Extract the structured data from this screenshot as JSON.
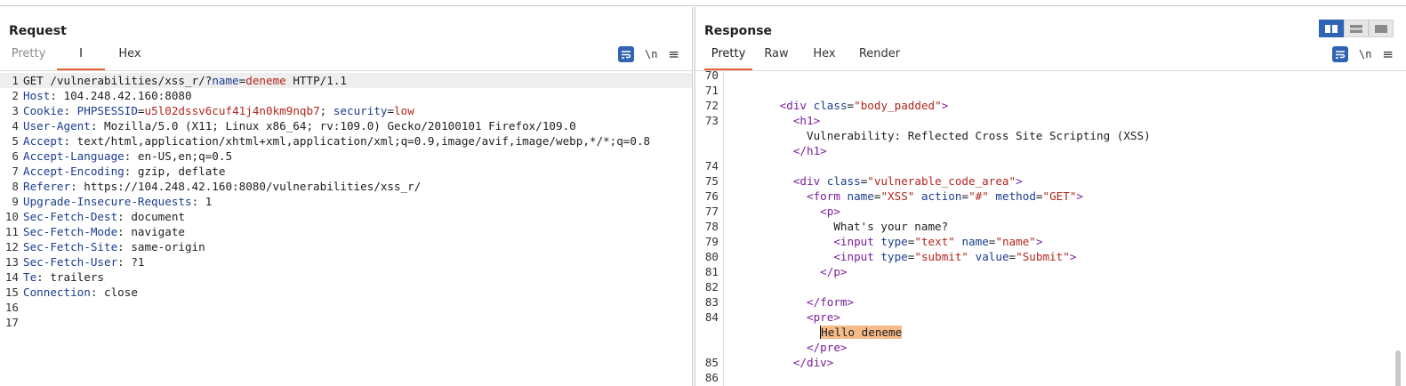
{
  "request": {
    "title": "Request",
    "tabs": [
      "Pretty",
      "I",
      "Hex"
    ],
    "toolbar": {
      "newline": "\\n",
      "menu": "≡"
    },
    "lines": [
      {
        "n": "1",
        "parts": [
          [
            "p",
            "GET /vulnerabilities/xss_r/?"
          ],
          [
            "k",
            "name"
          ],
          [
            "p",
            "="
          ],
          [
            "v",
            "deneme"
          ],
          [
            "p",
            " HTTP/1.1"
          ]
        ]
      },
      {
        "n": "2",
        "parts": [
          [
            "k",
            "Host"
          ],
          [
            "p",
            ": 104.248.42.160:8080"
          ]
        ]
      },
      {
        "n": "3",
        "parts": [
          [
            "k",
            "Cookie"
          ],
          [
            "p",
            ": "
          ],
          [
            "k",
            "PHPSESSID"
          ],
          [
            "p",
            "="
          ],
          [
            "v",
            "u5l02dssv6cuf41j4n0km9nqb7"
          ],
          [
            "p",
            "; "
          ],
          [
            "k",
            "security"
          ],
          [
            "p",
            "="
          ],
          [
            "v",
            "low"
          ]
        ]
      },
      {
        "n": "4",
        "parts": [
          [
            "k",
            "User-Agent"
          ],
          [
            "p",
            ": Mozilla/5.0 (X11; Linux x86_64; rv:109.0) Gecko/20100101 Firefox/109.0"
          ]
        ]
      },
      {
        "n": "5",
        "parts": [
          [
            "k",
            "Accept"
          ],
          [
            "p",
            ": text/html,application/xhtml+xml,application/xml;q=0.9,image/avif,image/webp,*/*;q=0.8"
          ]
        ]
      },
      {
        "n": "6",
        "parts": [
          [
            "k",
            "Accept-Language"
          ],
          [
            "p",
            ": en-US,en;q=0.5"
          ]
        ]
      },
      {
        "n": "7",
        "parts": [
          [
            "k",
            "Accept-Encoding"
          ],
          [
            "p",
            ": gzip, deflate"
          ]
        ]
      },
      {
        "n": "8",
        "parts": [
          [
            "k",
            "Referer"
          ],
          [
            "p",
            ": https://104.248.42.160:8080/vulnerabilities/xss_r/"
          ]
        ]
      },
      {
        "n": "9",
        "parts": [
          [
            "k",
            "Upgrade-Insecure-Requests"
          ],
          [
            "p",
            ": 1"
          ]
        ]
      },
      {
        "n": "10",
        "parts": [
          [
            "k",
            "Sec-Fetch-Dest"
          ],
          [
            "p",
            ": document"
          ]
        ]
      },
      {
        "n": "11",
        "parts": [
          [
            "k",
            "Sec-Fetch-Mode"
          ],
          [
            "p",
            ": navigate"
          ]
        ]
      },
      {
        "n": "12",
        "parts": [
          [
            "k",
            "Sec-Fetch-Site"
          ],
          [
            "p",
            ": same-origin"
          ]
        ]
      },
      {
        "n": "13",
        "parts": [
          [
            "k",
            "Sec-Fetch-User"
          ],
          [
            "p",
            ": ?1"
          ]
        ]
      },
      {
        "n": "14",
        "parts": [
          [
            "k",
            "Te"
          ],
          [
            "p",
            ": trailers"
          ]
        ]
      },
      {
        "n": "15",
        "parts": [
          [
            "k",
            "Connection"
          ],
          [
            "p",
            ": close"
          ]
        ]
      },
      {
        "n": "16",
        "parts": []
      },
      {
        "n": "17",
        "parts": []
      }
    ]
  },
  "response": {
    "title": "Response",
    "tabs": [
      "Pretty",
      "Raw",
      "Hex",
      "Render"
    ],
    "toolbar": {
      "newline": "\\n",
      "menu": "≡"
    },
    "lines": [
      {
        "n": "70",
        "parts": []
      },
      {
        "n": "71",
        "parts": []
      },
      {
        "n": "72",
        "parts": [
          [
            "p",
            "        "
          ],
          [
            "tag",
            "<div"
          ],
          [
            "p",
            " "
          ],
          [
            "attr",
            "class"
          ],
          [
            "p",
            "="
          ],
          [
            "str",
            "\"body_padded\""
          ],
          [
            "tag",
            ">"
          ]
        ]
      },
      {
        "n": "73",
        "parts": [
          [
            "p",
            "          "
          ],
          [
            "tag",
            "<h1>"
          ]
        ]
      },
      {
        "n": "",
        "parts": [
          [
            "p",
            "            Vulnerability: Reflected Cross Site Scripting (XSS)"
          ]
        ]
      },
      {
        "n": "",
        "parts": [
          [
            "p",
            "          "
          ],
          [
            "tag",
            "</h1>"
          ]
        ]
      },
      {
        "n": "74",
        "parts": []
      },
      {
        "n": "75",
        "parts": [
          [
            "p",
            "          "
          ],
          [
            "tag",
            "<div"
          ],
          [
            "p",
            " "
          ],
          [
            "attr",
            "class"
          ],
          [
            "p",
            "="
          ],
          [
            "str",
            "\"vulnerable_code_area\""
          ],
          [
            "tag",
            ">"
          ]
        ]
      },
      {
        "n": "76",
        "parts": [
          [
            "p",
            "            "
          ],
          [
            "tag",
            "<form"
          ],
          [
            "p",
            " "
          ],
          [
            "attr",
            "name"
          ],
          [
            "p",
            "="
          ],
          [
            "str",
            "\"XSS\""
          ],
          [
            "p",
            " "
          ],
          [
            "attr",
            "action"
          ],
          [
            "p",
            "="
          ],
          [
            "str",
            "\"#\""
          ],
          [
            "p",
            " "
          ],
          [
            "attr",
            "method"
          ],
          [
            "p",
            "="
          ],
          [
            "str",
            "\"GET\""
          ],
          [
            "tag",
            ">"
          ]
        ]
      },
      {
        "n": "77",
        "parts": [
          [
            "p",
            "              "
          ],
          [
            "tag",
            "<p>"
          ]
        ]
      },
      {
        "n": "78",
        "parts": [
          [
            "p",
            "                What's your name?"
          ]
        ]
      },
      {
        "n": "79",
        "parts": [
          [
            "p",
            "                "
          ],
          [
            "tag",
            "<input"
          ],
          [
            "p",
            " "
          ],
          [
            "attr",
            "type"
          ],
          [
            "p",
            "="
          ],
          [
            "str",
            "\"text\""
          ],
          [
            "p",
            " "
          ],
          [
            "attr",
            "name"
          ],
          [
            "p",
            "="
          ],
          [
            "str",
            "\"name\""
          ],
          [
            "tag",
            ">"
          ]
        ]
      },
      {
        "n": "80",
        "parts": [
          [
            "p",
            "                "
          ],
          [
            "tag",
            "<input"
          ],
          [
            "p",
            " "
          ],
          [
            "attr",
            "type"
          ],
          [
            "p",
            "="
          ],
          [
            "str",
            "\"submit\""
          ],
          [
            "p",
            " "
          ],
          [
            "attr",
            "value"
          ],
          [
            "p",
            "="
          ],
          [
            "str",
            "\"Submit\""
          ],
          [
            "tag",
            ">"
          ]
        ]
      },
      {
        "n": "81",
        "parts": [
          [
            "p",
            "              "
          ],
          [
            "tag",
            "</p>"
          ]
        ]
      },
      {
        "n": "82",
        "parts": []
      },
      {
        "n": "83",
        "parts": [
          [
            "p",
            "            "
          ],
          [
            "tag",
            "</form>"
          ]
        ]
      },
      {
        "n": "84",
        "parts": [
          [
            "p",
            "            "
          ],
          [
            "tag",
            "<pre>"
          ]
        ]
      },
      {
        "n": "",
        "parts": [
          [
            "p",
            "              "
          ],
          [
            "hl",
            "Hello deneme"
          ]
        ]
      },
      {
        "n": "",
        "parts": [
          [
            "p",
            "            "
          ],
          [
            "tag",
            "</pre>"
          ]
        ]
      },
      {
        "n": "85",
        "parts": [
          [
            "p",
            "          "
          ],
          [
            "tag",
            "</div>"
          ]
        ]
      },
      {
        "n": "86",
        "parts": []
      }
    ]
  },
  "colors": {
    "accent_tab": "#e8622c",
    "button_blue": "#2f64b4",
    "highlight": "#f5bc8a"
  },
  "icons": [
    "wrap-lines-icon",
    "newline-toggle-icon",
    "hamburger-menu-icon",
    "layout-split-vertical-icon",
    "layout-split-horizontal-icon",
    "layout-tabs-icon"
  ]
}
